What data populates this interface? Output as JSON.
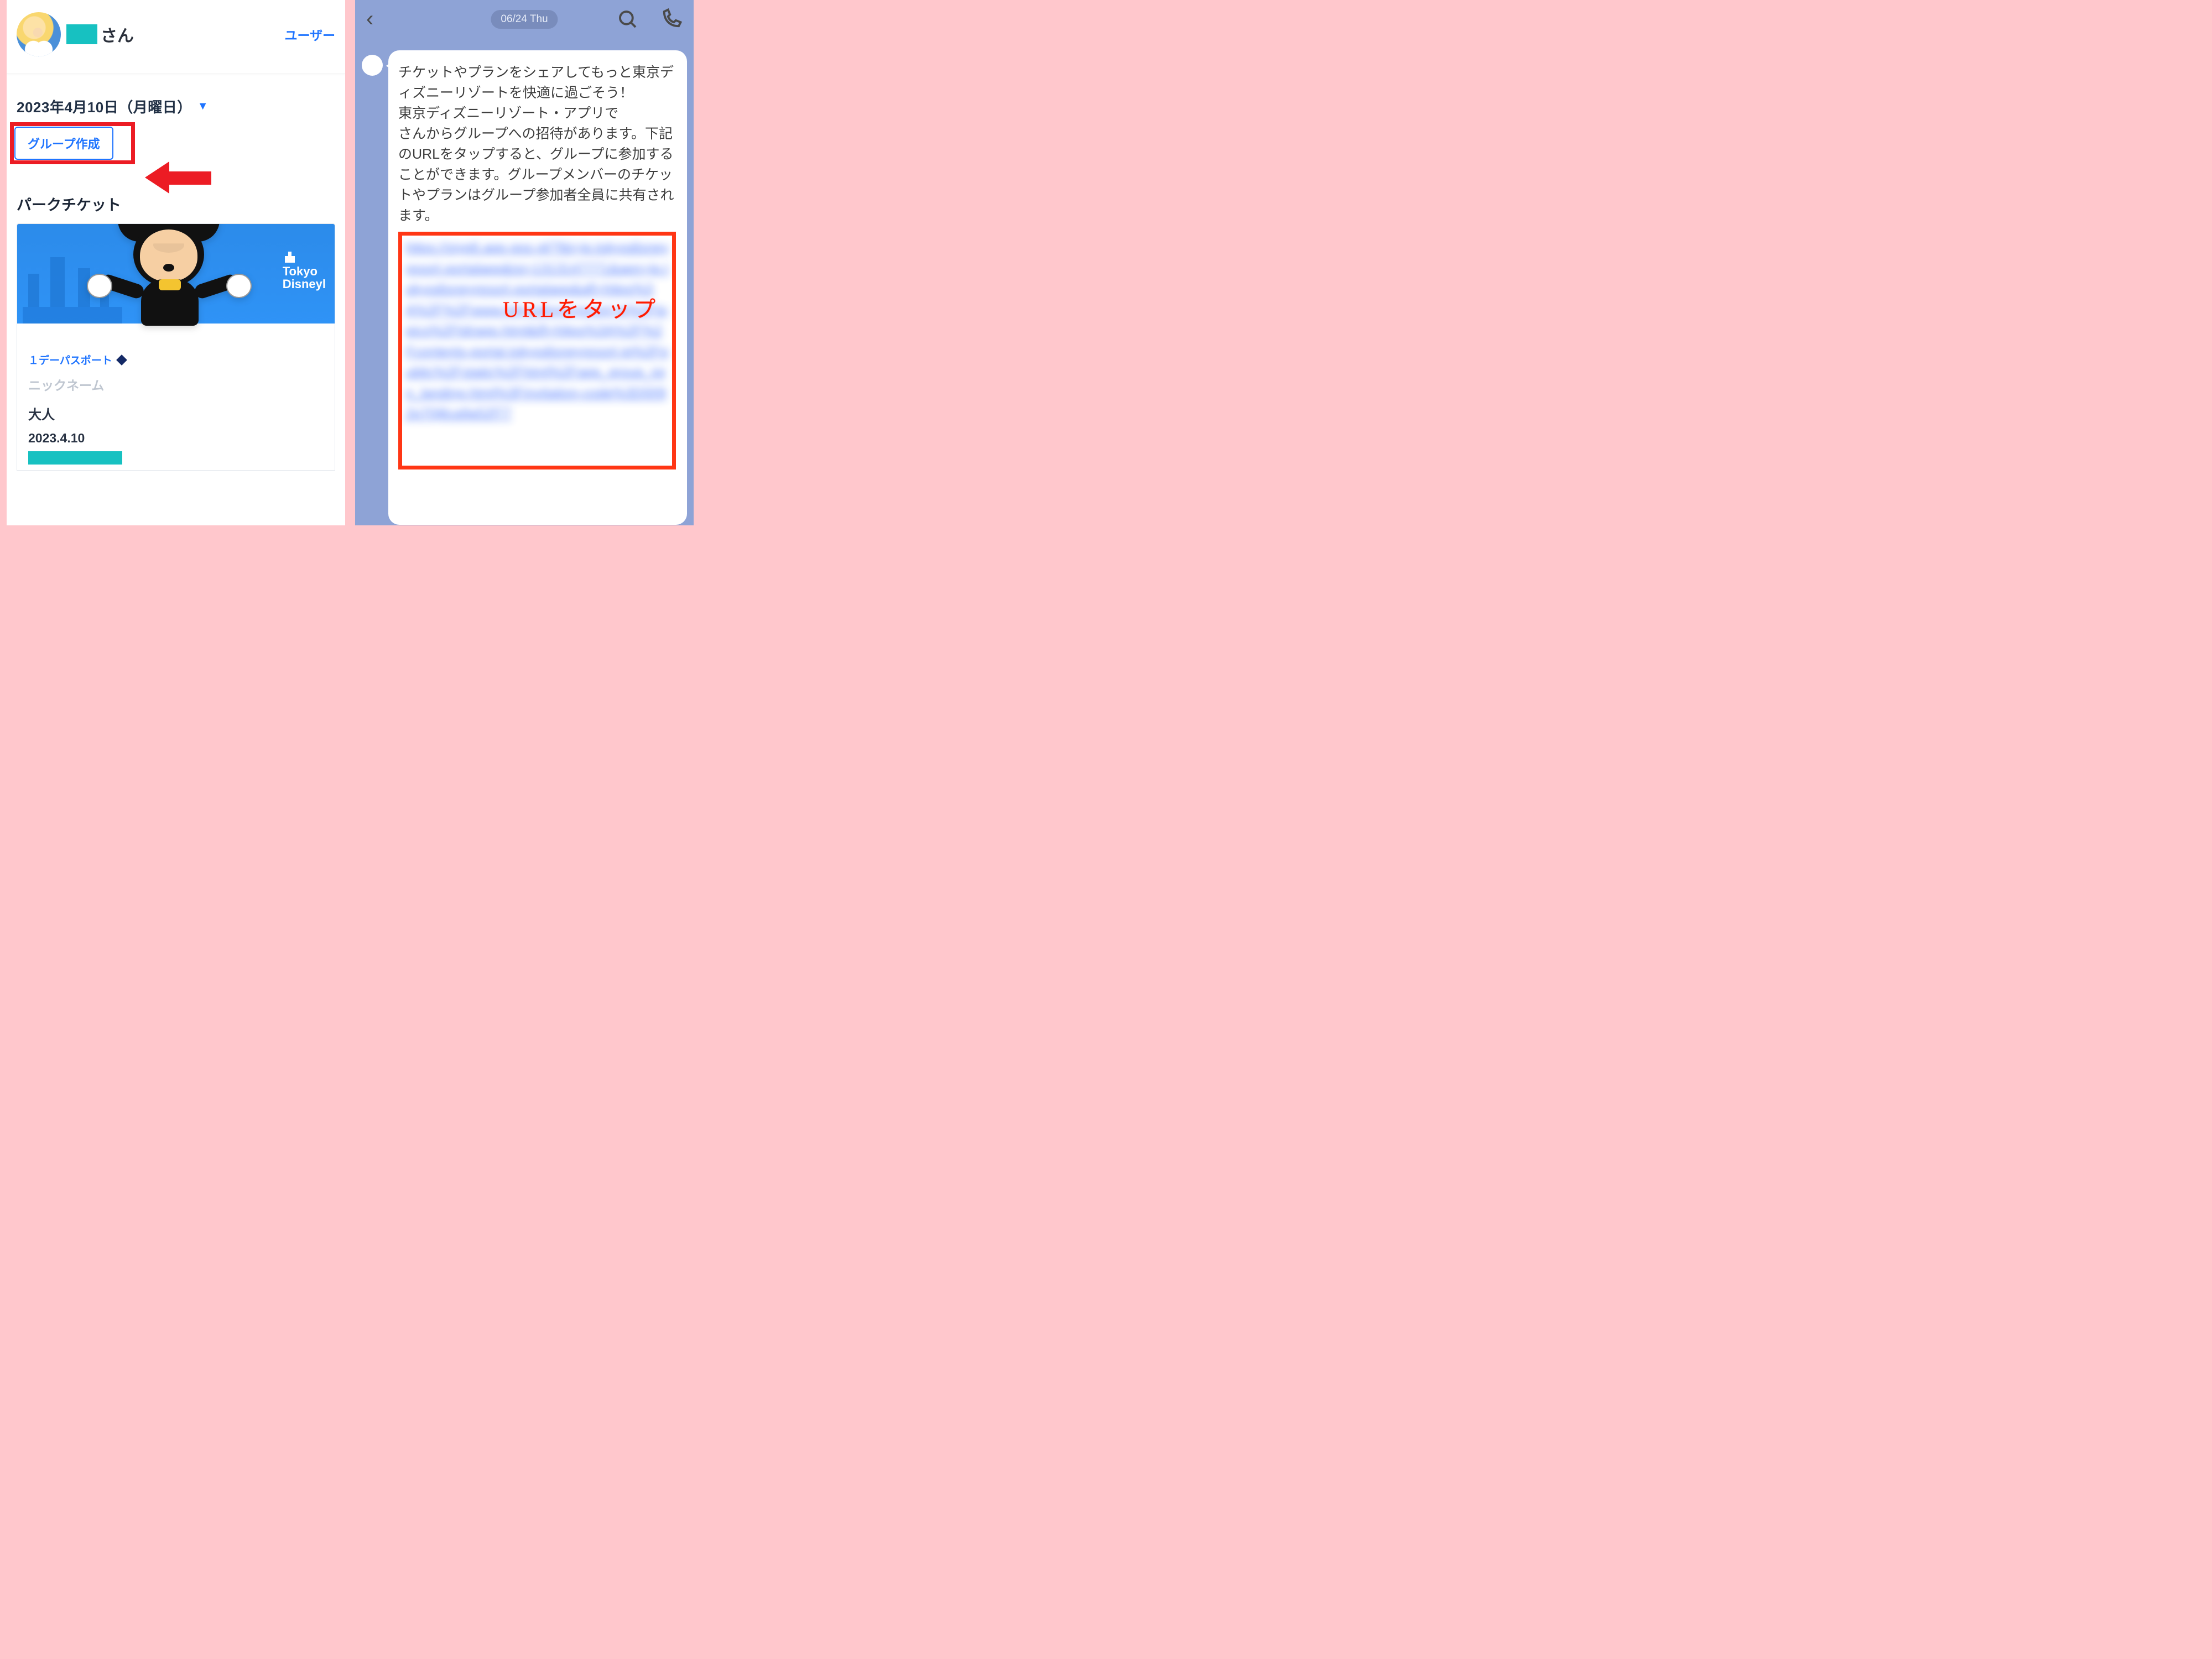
{
  "left": {
    "user_suffix": "さん",
    "user_link": "ユーザー",
    "date_label": "2023年4月10日（月曜日）",
    "group_button": "グループ作成",
    "section_title": "パークチケット",
    "brand_line1": "Tokyo",
    "brand_line2": "Disneyl",
    "passport_label": "１デーパスポート",
    "nickname_label": "ニックネーム",
    "adult_label": "大人",
    "ticket_date": "2023.4.10"
  },
  "right": {
    "date_badge": "06/24 Thu",
    "message": "チケットやプランをシェアしてもっと東京ディズニーリゾートを快適に過ごそう！\n東京ディズニーリゾート・アプリで　　　　さんからグループへの招待があります。下記のURLをタップすると、グループに参加することができます。グループメンバーのチケットやプランはグループ参加者全員に共有されます。",
    "url_blur": "https://siyp6.app.goo.gl/?ibi=jp.tokyodisneyresort.portalapp&isi=1313147771&apn=jp.tokyodisneyresort.portalapp&afl=https%3A%2F%2Fwww.tokyodisneyresort.jp%2Ftopics%2Ftdrapp.html&ifl=https%3A%2F%2Fcontents-portal.tokyodisneyresort.jp%2Fpublic%2Fstatic%2Fhtml%2Fapp_group_join_landing.html%3Finvitation-code%3D0092p70j8ca9a52f77",
    "overlay": "URLをタップ"
  }
}
